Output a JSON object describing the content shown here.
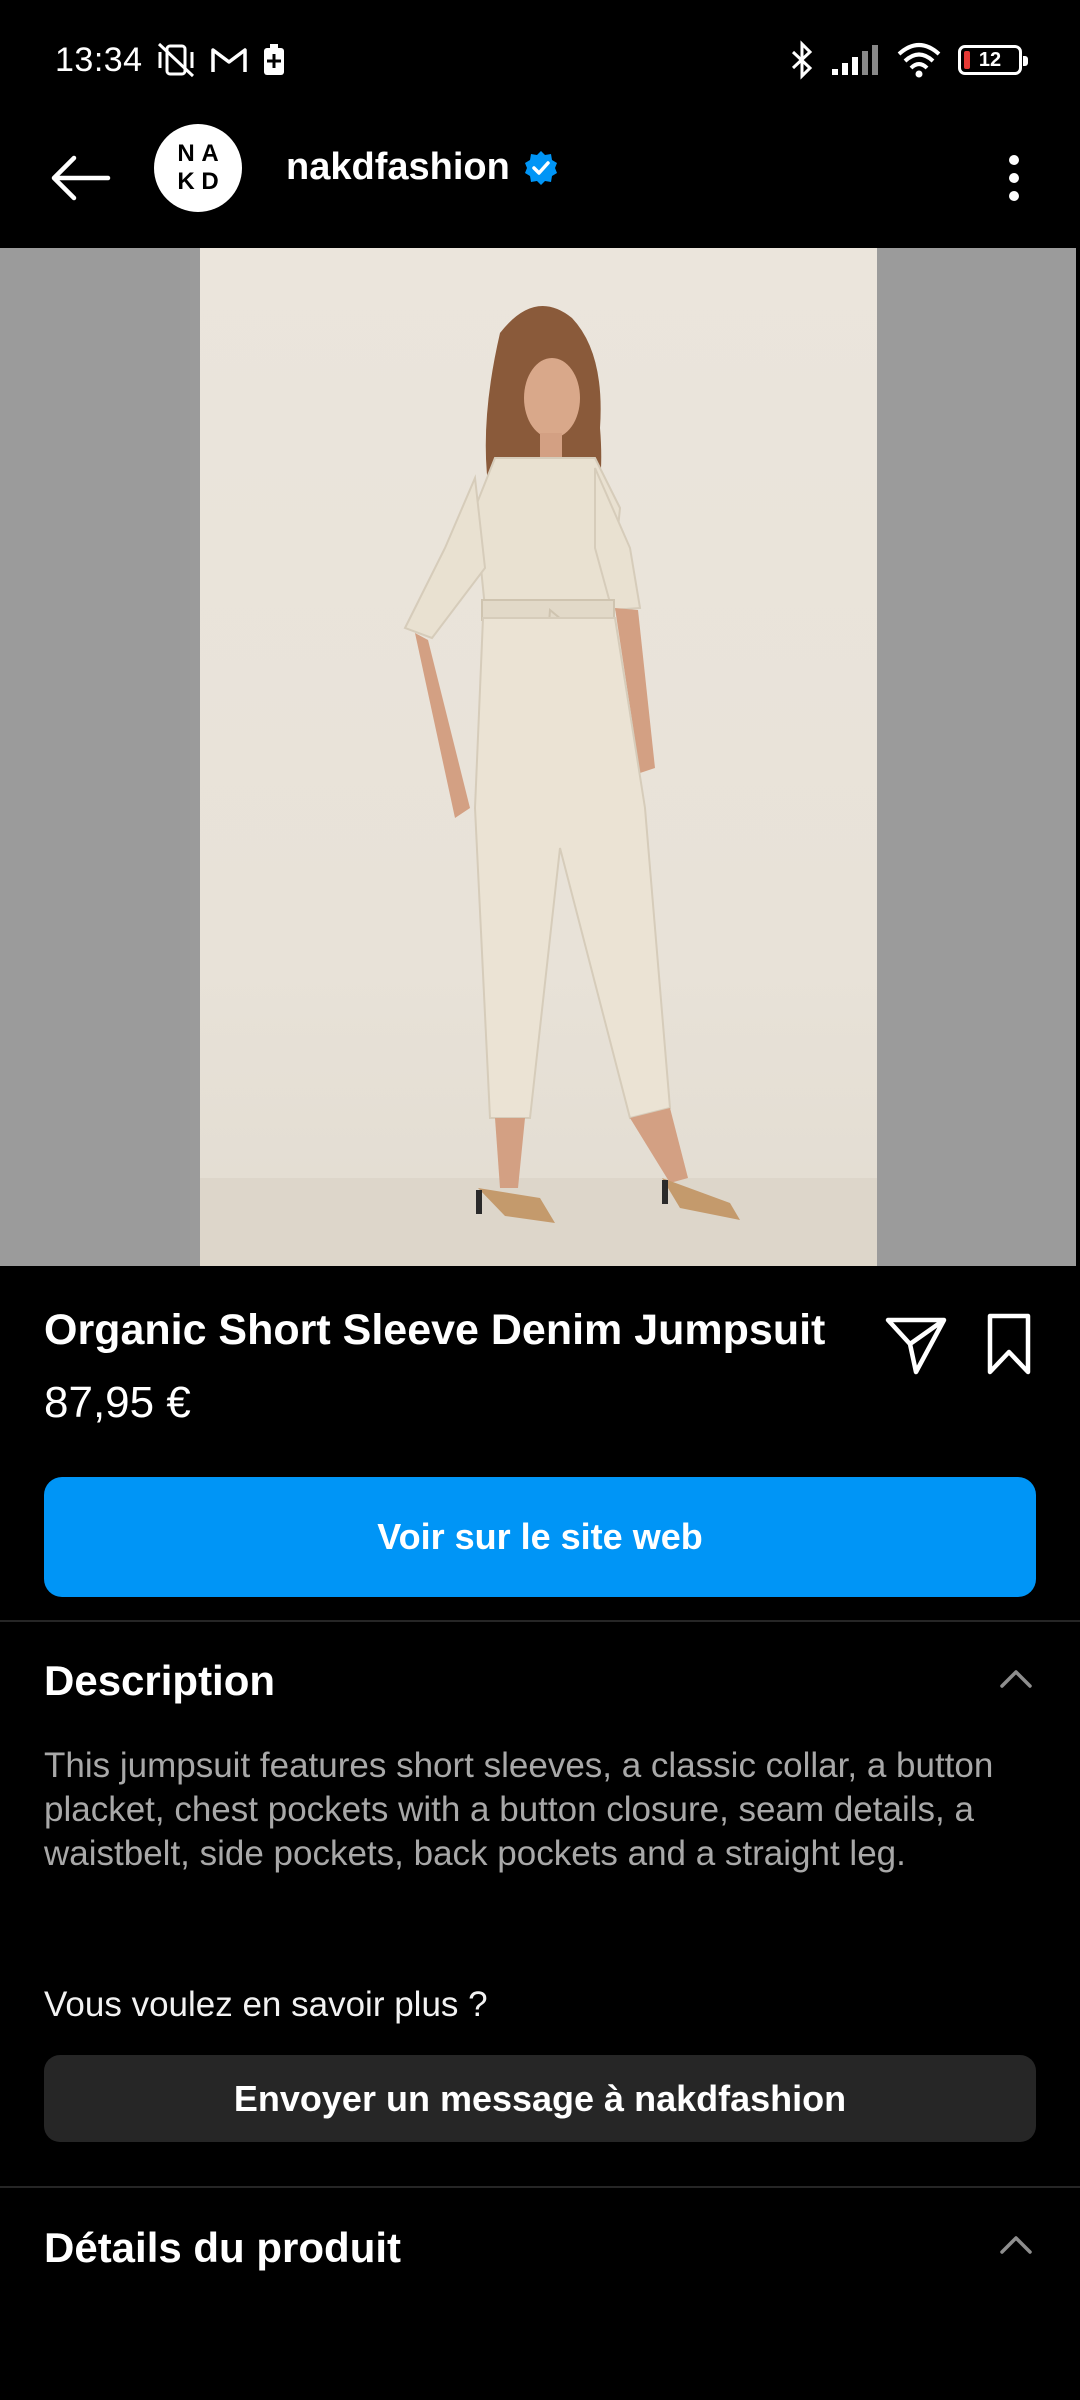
{
  "status_bar": {
    "time": "13:34",
    "battery_level": "12",
    "icons": [
      "vibrate-off-icon",
      "gmail-icon",
      "battery-saver-icon",
      "bluetooth-icon",
      "signal-icon",
      "wifi-icon",
      "battery-icon"
    ]
  },
  "header": {
    "avatar_letters": [
      "N",
      "A",
      "K",
      "D"
    ],
    "username": "nakdfashion",
    "verified": true
  },
  "product": {
    "title": "Organic Short Sleeve Denim Jumpsuit",
    "price": "87,95 €",
    "cta_label": "Voir sur le site web"
  },
  "description": {
    "heading": "Description",
    "text": "This jumpsuit features short sleeves, a classic collar, a button placket, chest pockets with a button closure, seam details, a waistbelt, side pockets, back pockets and a straight leg.",
    "learn_more": "Vous voulez en savoir plus ?",
    "message_button": "Envoyer un message à nakdfashion"
  },
  "details": {
    "heading": "Détails du produit"
  },
  "colors": {
    "accent": "#0095f6",
    "verified_badge": "#0095f6",
    "background": "#000000",
    "secondary_button": "#262626"
  }
}
